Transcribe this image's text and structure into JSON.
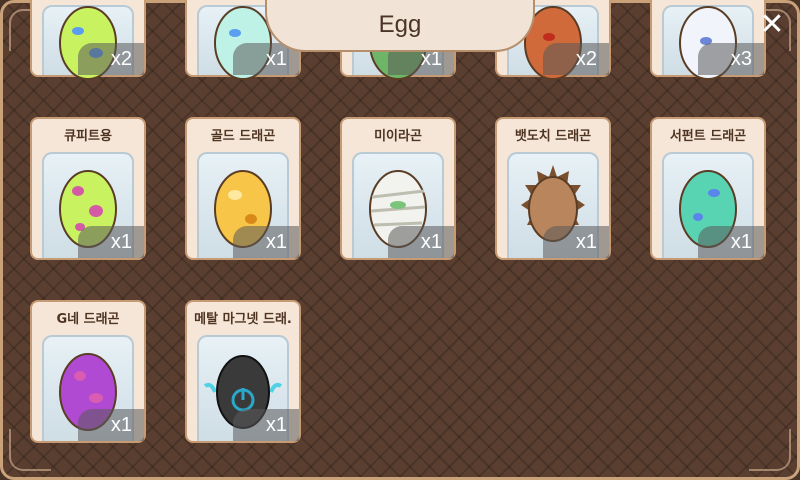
{
  "header": {
    "title": "Egg"
  },
  "close_label": "✕",
  "eggs": [
    {
      "name": "",
      "count": "x2",
      "color1": "#c9f260",
      "color2": "#8ad23c",
      "spots": "#5a9df0"
    },
    {
      "name": "",
      "count": "x1",
      "color1": "#bff2e6",
      "color2": "#86dcc5",
      "spots": "#5b9ff0"
    },
    {
      "name": "",
      "count": "x1",
      "color1": "#6fb567",
      "color2": "#4d8a47",
      "spots": "#2e6d2d"
    },
    {
      "name": "",
      "count": "x2",
      "color1": "#d06a3a",
      "color2": "#a8431f",
      "spots": "#c12d1d"
    },
    {
      "name": "",
      "count": "x3",
      "color1": "#f2f4fb",
      "color2": "#c6cde7",
      "spots": "#6c86d8"
    },
    {
      "name": "큐피트용",
      "count": "x1",
      "color1": "#c9f260",
      "color2": "#8ad23c",
      "spots": "#d45aa6"
    },
    {
      "name": "골드 드래곤",
      "count": "x1",
      "color1": "#f7c548",
      "color2": "#d9891a",
      "spots": "#ffe8a0"
    },
    {
      "name": "미이라곤",
      "count": "x1",
      "color1": "#f2f2ef",
      "color2": "#cfcfc5",
      "spots": "#7ac47b"
    },
    {
      "name": "뱃도치 드래곤",
      "count": "x1",
      "color1": "#b9855c",
      "color2": "#7a4f2e",
      "spots": "#5a3520"
    },
    {
      "name": "서펀트 드래곤",
      "count": "x1",
      "color1": "#58d4b3",
      "color2": "#2b9b80",
      "spots": "#5b86e9"
    },
    {
      "name": "G네 드래곤",
      "count": "x1",
      "color1": "#b14ad3",
      "color2": "#7d2aa0",
      "spots": "#d95cb3"
    },
    {
      "name": "메탈 마그넷 드래.",
      "count": "x1",
      "color1": "#3a3a3a",
      "color2": "#161616",
      "spots": "#2aa7c9"
    }
  ]
}
